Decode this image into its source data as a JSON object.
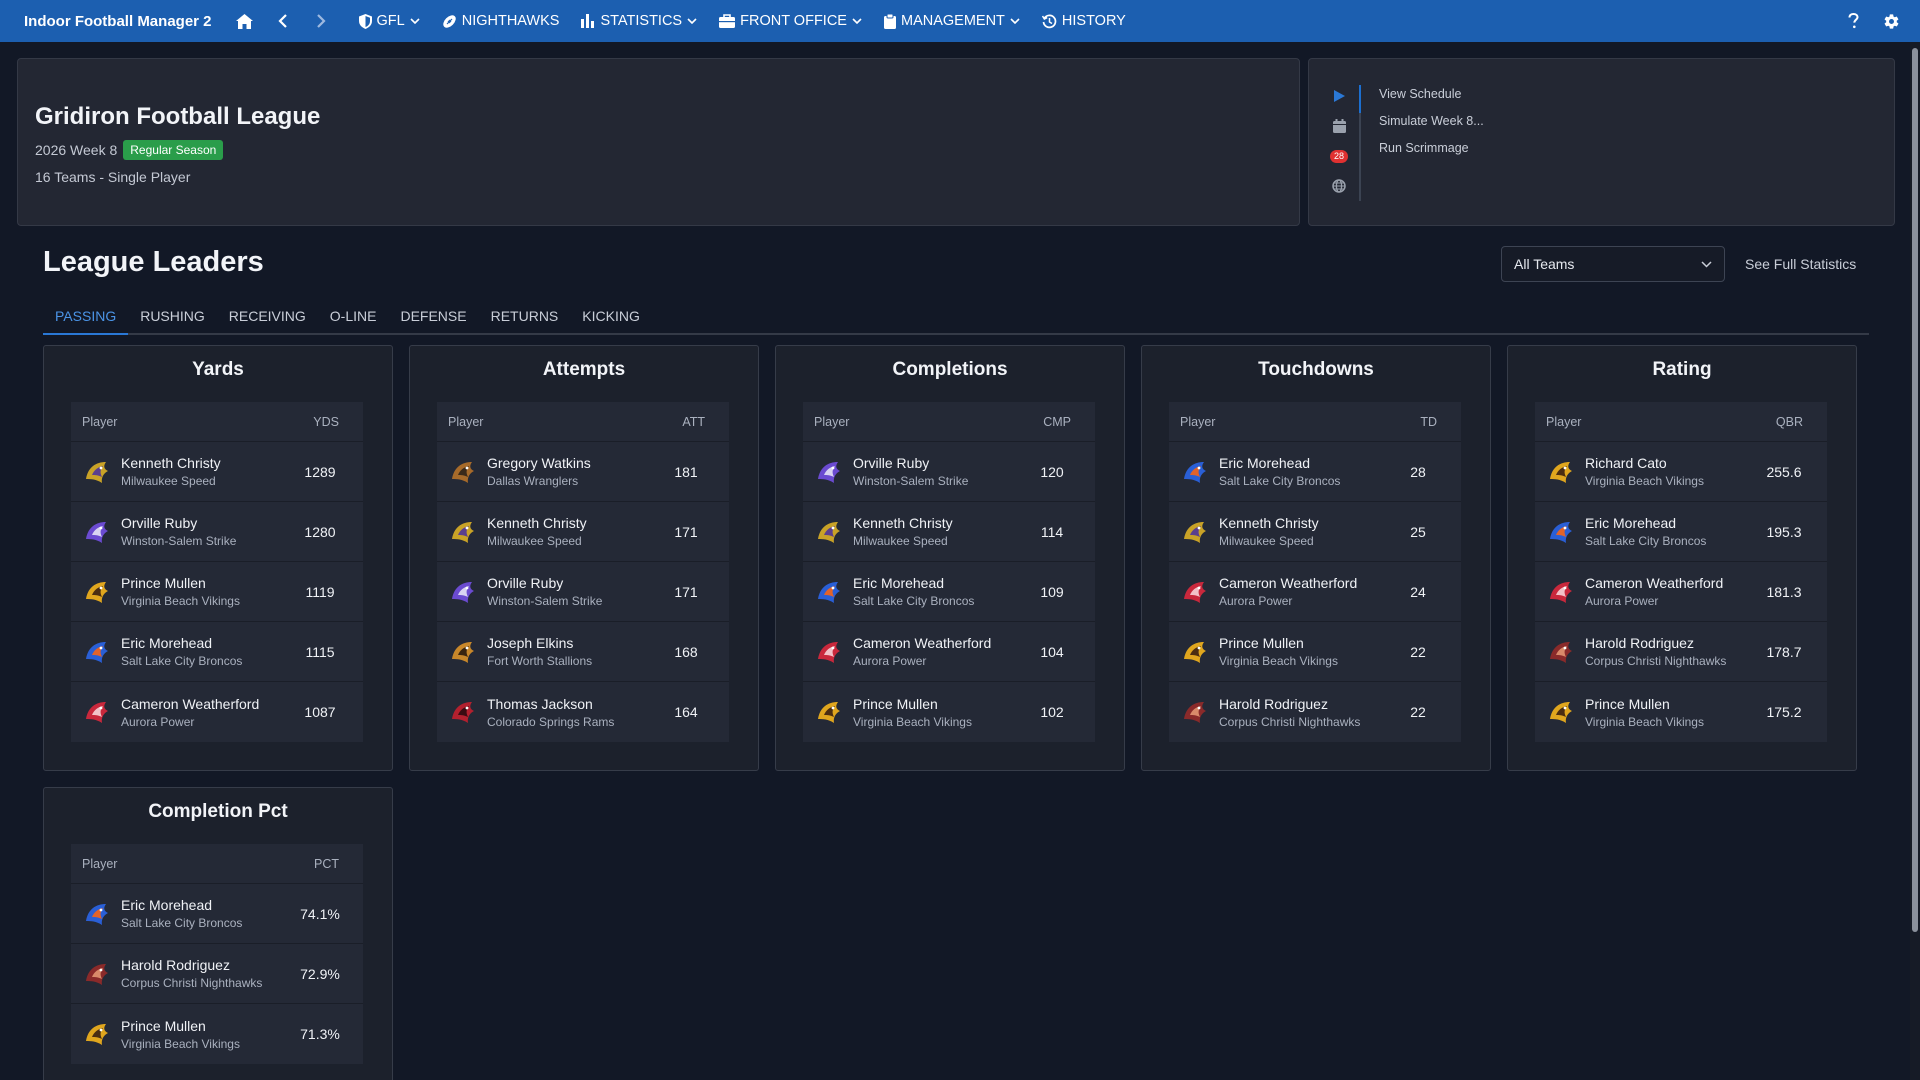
{
  "nav": {
    "brand": "Indoor Football Manager 2",
    "items": [
      {
        "label": "GFL",
        "icon": "shield-icon",
        "dropdown": true
      },
      {
        "label": "NIGHTHAWKS",
        "icon": "football-icon",
        "dropdown": false
      },
      {
        "label": "STATISTICS",
        "icon": "bar-chart-icon",
        "dropdown": true
      },
      {
        "label": "FRONT OFFICE",
        "icon": "briefcase-icon",
        "dropdown": true
      },
      {
        "label": "MANAGEMENT",
        "icon": "clipboard-icon",
        "dropdown": true
      },
      {
        "label": "HISTORY",
        "icon": "history-icon",
        "dropdown": false
      }
    ]
  },
  "league": {
    "title": "Gridiron Football League",
    "season": "2026 Week 8",
    "phase": "Regular Season",
    "info": "16 Teams - Single Player"
  },
  "actions": {
    "notification_count": "28",
    "links": [
      "View Schedule",
      "Simulate Week 8...",
      "Run Scrimmage"
    ]
  },
  "leaders": {
    "title": "League Leaders",
    "team_filter": "All Teams",
    "full_stats_link": "See Full Statistics",
    "tabs": [
      "PASSING",
      "RUSHING",
      "RECEIVING",
      "O-LINE",
      "DEFENSE",
      "RETURNS",
      "KICKING"
    ],
    "active_tab": "PASSING",
    "player_col": "Player",
    "cards": [
      {
        "title": "Yards",
        "stat": "YDS",
        "rows": [
          {
            "name": "Kenneth Christy",
            "team": "Milwaukee Speed",
            "value": "1289",
            "logo": "speed"
          },
          {
            "name": "Orville Ruby",
            "team": "Winston-Salem Strike",
            "value": "1280",
            "logo": "strike"
          },
          {
            "name": "Prince Mullen",
            "team": "Virginia Beach Vikings",
            "value": "1119",
            "logo": "vikings"
          },
          {
            "name": "Eric Morehead",
            "team": "Salt Lake City Broncos",
            "value": "1115",
            "logo": "broncos"
          },
          {
            "name": "Cameron Weatherford",
            "team": "Aurora Power",
            "value": "1087",
            "logo": "power"
          }
        ]
      },
      {
        "title": "Attempts",
        "stat": "ATT",
        "rows": [
          {
            "name": "Gregory Watkins",
            "team": "Dallas Wranglers",
            "value": "181",
            "logo": "wranglers"
          },
          {
            "name": "Kenneth Christy",
            "team": "Milwaukee Speed",
            "value": "171",
            "logo": "speed"
          },
          {
            "name": "Orville Ruby",
            "team": "Winston-Salem Strike",
            "value": "171",
            "logo": "strike"
          },
          {
            "name": "Joseph Elkins",
            "team": "Fort Worth Stallions",
            "value": "168",
            "logo": "stallions"
          },
          {
            "name": "Thomas Jackson",
            "team": "Colorado Springs Rams",
            "value": "164",
            "logo": "rams"
          }
        ]
      },
      {
        "title": "Completions",
        "stat": "CMP",
        "rows": [
          {
            "name": "Orville Ruby",
            "team": "Winston-Salem Strike",
            "value": "120",
            "logo": "strike"
          },
          {
            "name": "Kenneth Christy",
            "team": "Milwaukee Speed",
            "value": "114",
            "logo": "speed"
          },
          {
            "name": "Eric Morehead",
            "team": "Salt Lake City Broncos",
            "value": "109",
            "logo": "broncos"
          },
          {
            "name": "Cameron Weatherford",
            "team": "Aurora Power",
            "value": "104",
            "logo": "power"
          },
          {
            "name": "Prince Mullen",
            "team": "Virginia Beach Vikings",
            "value": "102",
            "logo": "vikings"
          }
        ]
      },
      {
        "title": "Touchdowns",
        "stat": "TD",
        "rows": [
          {
            "name": "Eric Morehead",
            "team": "Salt Lake City Broncos",
            "value": "28",
            "logo": "broncos"
          },
          {
            "name": "Kenneth Christy",
            "team": "Milwaukee Speed",
            "value": "25",
            "logo": "speed"
          },
          {
            "name": "Cameron Weatherford",
            "team": "Aurora Power",
            "value": "24",
            "logo": "power"
          },
          {
            "name": "Prince Mullen",
            "team": "Virginia Beach Vikings",
            "value": "22",
            "logo": "vikings"
          },
          {
            "name": "Harold Rodriguez",
            "team": "Corpus Christi Nighthawks",
            "value": "22",
            "logo": "nighthawks"
          }
        ]
      },
      {
        "title": "Rating",
        "stat": "QBR",
        "rows": [
          {
            "name": "Richard Cato",
            "team": "Virginia Beach Vikings",
            "value": "255.6",
            "logo": "vikings"
          },
          {
            "name": "Eric Morehead",
            "team": "Salt Lake City Broncos",
            "value": "195.3",
            "logo": "broncos"
          },
          {
            "name": "Cameron Weatherford",
            "team": "Aurora Power",
            "value": "181.3",
            "logo": "power"
          },
          {
            "name": "Harold Rodriguez",
            "team": "Corpus Christi Nighthawks",
            "value": "178.7",
            "logo": "nighthawks"
          },
          {
            "name": "Prince Mullen",
            "team": "Virginia Beach Vikings",
            "value": "175.2",
            "logo": "vikings"
          }
        ]
      },
      {
        "title": "Completion Pct",
        "stat": "PCT",
        "rows": [
          {
            "name": "Eric Morehead",
            "team": "Salt Lake City Broncos",
            "value": "74.1%",
            "logo": "broncos"
          },
          {
            "name": "Harold Rodriguez",
            "team": "Corpus Christi Nighthawks",
            "value": "72.9%",
            "logo": "nighthawks"
          },
          {
            "name": "Prince Mullen",
            "team": "Virginia Beach Vikings",
            "value": "71.3%",
            "logo": "vikings"
          }
        ]
      }
    ]
  },
  "colors": {
    "nav_bar": "#1c5fb0",
    "background": "#121826",
    "panel": "#232733",
    "accent": "#2a78d6",
    "badge_green": "#2a9d4a",
    "notif_red": "#e03131"
  }
}
